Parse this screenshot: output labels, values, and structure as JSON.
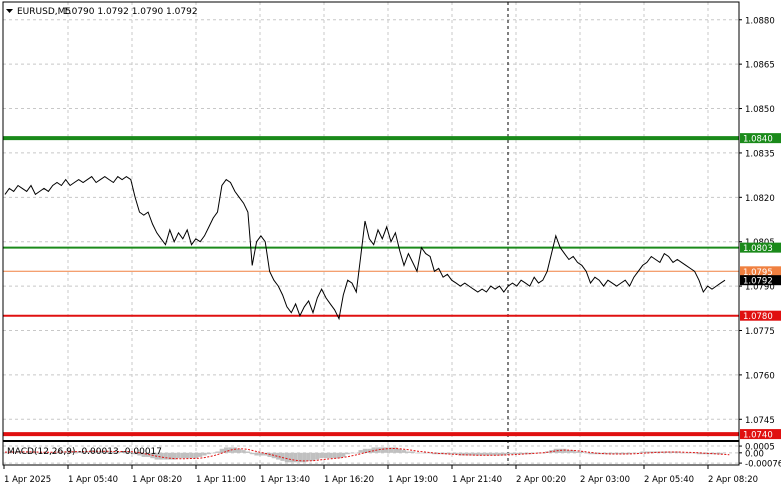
{
  "header": {
    "symbol": "EURUSD,M5",
    "ohlc": "1.0790 1.0792 1.0790 1.0792"
  },
  "price_axis": {
    "labels": [
      "1.0880",
      "1.0865",
      "1.0850",
      "1.0835",
      "1.0820",
      "1.0805",
      "1.0790",
      "1.0775",
      "1.0760",
      "1.0745"
    ],
    "values": [
      1.088,
      1.0865,
      1.085,
      1.0835,
      1.082,
      1.0805,
      1.079,
      1.0775,
      1.076,
      1.0745
    ]
  },
  "levels": [
    {
      "label": "1.0840",
      "value": 1.084,
      "color": "#1a8a1a",
      "thick": true
    },
    {
      "label": "1.0803",
      "value": 1.0803,
      "color": "#1a8a1a",
      "thick": false
    },
    {
      "label": "1.0795",
      "value": 1.0795,
      "color": "#f08040",
      "thick": false
    },
    {
      "label": "1.0792",
      "value": 1.0792,
      "color": "#000000",
      "thick": false
    },
    {
      "label": "1.0780",
      "value": 1.078,
      "color": "#e01010",
      "thick": false
    },
    {
      "label": "1.0740",
      "value": 1.074,
      "color": "#e01010",
      "thick": true
    }
  ],
  "macd": {
    "title": "MACD(12,26,9) -0.00013 -0.00017",
    "axis_labels": [
      "0.0005",
      "0.00",
      "-0.00076"
    ],
    "axis_values": [
      0.0005,
      0.0,
      -0.00076
    ]
  },
  "time_axis": {
    "labels": [
      "1 Apr 2025",
      "1 Apr 05:40",
      "1 Apr 08:20",
      "1 Apr 11:00",
      "1 Apr 13:40",
      "1 Apr 16:20",
      "1 Apr 19:00",
      "1 Apr 21:40",
      "2 Apr 00:20",
      "2 Apr 03:00",
      "2 Apr 05:40",
      "2 Apr 08:20"
    ]
  },
  "chart_data": {
    "type": "line",
    "title": "EURUSD,M5",
    "xlabel": "",
    "ylabel": "",
    "ylim": [
      1.0738,
      1.0886
    ],
    "grid": true,
    "series": [
      {
        "values": [
          1.0821,
          1.0823,
          1.0822,
          1.0824,
          1.0823,
          1.0822,
          1.0824,
          1.0821,
          1.0822,
          1.0823,
          1.0822,
          1.0824,
          1.0825,
          1.0824,
          1.0826,
          1.0824,
          1.0825,
          1.0826,
          1.0825,
          1.0826,
          1.0827,
          1.0825,
          1.0826,
          1.0827,
          1.0826,
          1.0825,
          1.0827,
          1.0826,
          1.0827,
          1.0826,
          1.082,
          1.0815,
          1.0814,
          1.0815,
          1.0811,
          1.0808,
          1.0806,
          1.0804,
          1.0809,
          1.0805,
          1.0808,
          1.0806,
          1.0809,
          1.0804,
          1.0806,
          1.0805,
          1.0807,
          1.081,
          1.0813,
          1.0815,
          1.0824,
          1.0826,
          1.0825,
          1.0822,
          1.082,
          1.0818,
          1.0815,
          1.0797,
          1.0805,
          1.0807,
          1.0805,
          1.0795,
          1.0792,
          1.079,
          1.0787,
          1.0783,
          1.0781,
          1.0784,
          1.078,
          1.0783,
          1.0785,
          1.0781,
          1.0786,
          1.0789,
          1.0786,
          1.0784,
          1.0782,
          1.0779,
          1.0787,
          1.0792,
          1.0791,
          1.0788,
          1.08,
          1.0812,
          1.0806,
          1.0804,
          1.0809,
          1.0806,
          1.081,
          1.0805,
          1.0808,
          1.0802,
          1.0797,
          1.0801,
          1.0798,
          1.0795,
          1.0803,
          1.0801,
          1.08,
          1.0795,
          1.0796,
          1.0793,
          1.0794,
          1.0792,
          1.0791,
          1.079,
          1.0791,
          1.079,
          1.0789,
          1.0788,
          1.0789,
          1.0788,
          1.079,
          1.0789,
          1.079,
          1.0788,
          1.079,
          1.0791,
          1.079,
          1.0792,
          1.0791,
          1.079,
          1.0793,
          1.0791,
          1.0792,
          1.0795,
          1.0801,
          1.0807,
          1.0803,
          1.0801,
          1.0799,
          1.08,
          1.0798,
          1.0797,
          1.0795,
          1.0791,
          1.0793,
          1.0792,
          1.079,
          1.0792,
          1.0791,
          1.079,
          1.0791,
          1.0792,
          1.079,
          1.0793,
          1.0795,
          1.0797,
          1.0798,
          1.08,
          1.0799,
          1.0798,
          1.0801,
          1.08,
          1.0798,
          1.0799,
          1.0798,
          1.0797,
          1.0796,
          1.0795,
          1.0792,
          1.0788,
          1.079,
          1.0789,
          1.079,
          1.0791,
          1.0792
        ]
      }
    ]
  },
  "macd_data": {
    "histogram": [
      0.0,
      0.0,
      0.0001,
      0.0001,
      0.0001,
      0.0,
      0.0001,
      0.0,
      0.0,
      0.0,
      0.0,
      0.0,
      0.0001,
      0.0001,
      0.0001,
      0.0001,
      0.0001,
      0.0001,
      0.0001,
      0.0001,
      0.0002,
      0.0001,
      0.0001,
      0.0001,
      0.0001,
      0.0001,
      0.0001,
      0.0001,
      0.0001,
      0.0001,
      -0.0001,
      -0.0002,
      -0.0003,
      -0.0003,
      -0.0004,
      -0.0005,
      -0.0005,
      -0.0005,
      -0.0005,
      -0.0005,
      -0.0004,
      -0.0004,
      -0.0004,
      -0.0004,
      -0.0004,
      -0.0003,
      -0.0002,
      -0.0001,
      0.0,
      0.0001,
      0.0003,
      0.0004,
      0.0004,
      0.0004,
      0.0003,
      0.0002,
      0.0001,
      -0.0001,
      -0.0002,
      -0.0002,
      -0.0002,
      -0.0003,
      -0.0004,
      -0.0005,
      -0.0006,
      -0.0007,
      -0.0007,
      -0.0007,
      -0.0007,
      -0.0007,
      -0.0006,
      -0.0006,
      -0.0005,
      -0.0004,
      -0.0004,
      -0.0004,
      -0.0004,
      -0.0004,
      -0.0003,
      -0.0001,
      0.0,
      0.0,
      0.0002,
      0.0003,
      0.0003,
      0.0004,
      0.0004,
      0.0004,
      0.0004,
      0.0004,
      0.0004,
      0.0003,
      0.0002,
      0.0001,
      0.0001,
      0.0,
      0.0,
      0.0,
      0.0,
      -0.0001,
      -0.0001,
      -0.0001,
      -0.0001,
      -0.0001,
      -0.0001,
      -0.0002,
      -0.0002,
      -0.0002,
      -0.0002,
      -0.0002,
      -0.0002,
      -0.0002,
      -0.0002,
      -0.0002,
      -0.0002,
      -0.0002,
      -0.0001,
      -0.0001,
      -0.0001,
      -0.0001,
      -0.0001,
      -0.0001,
      0.0,
      0.0,
      0.0,
      0.0001,
      0.0002,
      0.0003,
      0.0003,
      0.0003,
      0.0002,
      0.0002,
      0.0001,
      0.0001,
      0.0,
      -0.0001,
      -0.0001,
      -0.0001,
      -0.0001,
      -0.0001,
      -0.0001,
      -0.0001,
      -0.0001,
      -0.0001,
      -0.0001,
      0.0,
      0.0,
      0.0001,
      0.0001,
      0.0001,
      0.0001,
      0.0001,
      0.0001,
      0.0001,
      0.0001,
      0.0001,
      0.0,
      0.0,
      0.0,
      0.0,
      -0.0001,
      -0.0001,
      -0.0001,
      -0.0001,
      -0.0001,
      -0.0001
    ],
    "signal": [
      5e-05,
      5e-05,
      6e-05,
      7e-05,
      7e-05,
      7e-05,
      7e-05,
      6e-05,
      5e-05,
      4e-05,
      4e-05,
      4e-05,
      5e-05,
      6e-05,
      7e-05,
      8e-05,
      8e-05,
      9e-05,
      9e-05,
      0.0001,
      0.00011,
      0.00011,
      0.00011,
      0.00011,
      0.00011,
      0.0001,
      0.0001,
      0.0001,
      0.0001,
      9e-05,
      5e-05,
      0.0,
      -6e-05,
      -0.00012,
      -0.00018,
      -0.00025,
      -0.00031,
      -0.00036,
      -0.0004,
      -0.00043,
      -0.00044,
      -0.00044,
      -0.00043,
      -0.00042,
      -0.00041,
      -0.00039,
      -0.00035,
      -0.00029,
      -0.00022,
      -0.00013,
      -2e-05,
      0.0001,
      0.0002,
      0.00027,
      0.0003,
      0.00029,
      0.00025,
      0.00018,
      0.0001,
      3e-05,
      -4e-05,
      -0.00011,
      -0.00019,
      -0.00027,
      -0.00035,
      -0.00043,
      -0.0005,
      -0.00055,
      -0.00058,
      -0.0006,
      -0.0006,
      -0.00058,
      -0.00055,
      -0.00051,
      -0.00047,
      -0.00044,
      -0.00041,
      -0.00038,
      -0.00034,
      -0.00029,
      -0.00022,
      -0.00015,
      -7e-05,
      1e-05,
      9e-05,
      0.00016,
      0.00022,
      0.00027,
      0.0003,
      0.00032,
      0.00032,
      0.0003,
      0.00027,
      0.00023,
      0.00018,
      0.00013,
      9e-05,
      5e-05,
      2e-05,
      -1e-05,
      -4e-05,
      -6e-05,
      -8e-05,
      -0.0001,
      -0.00012,
      -0.00014,
      -0.00015,
      -0.00016,
      -0.00017,
      -0.00018,
      -0.00018,
      -0.00018,
      -0.00018,
      -0.00018,
      -0.00017,
      -0.00016,
      -0.00015,
      -0.00014,
      -0.00012,
      -0.0001,
      -8e-05,
      -6e-05,
      -4e-05,
      -2e-05,
      0.0,
      4e-05,
      9e-05,
      0.00014,
      0.00018,
      0.0002,
      0.0002,
      0.00018,
      0.00015,
      0.00011,
      7e-05,
      3e-05,
      -1e-05,
      -4e-05,
      -6e-05,
      -8e-05,
      -9e-05,
      -9e-05,
      -9e-05,
      -9e-05,
      -8e-05,
      -7e-05,
      -5e-05,
      -3e-05,
      -1e-05,
      1e-05,
      3e-05,
      4e-05,
      5e-05,
      6e-05,
      6e-05,
      6e-05,
      5e-05,
      4e-05,
      3e-05,
      2e-05,
      0.0,
      -2e-05,
      -4e-05,
      -6e-05,
      -8e-05,
      -0.0001,
      -0.00012,
      -0.00014
    ]
  }
}
